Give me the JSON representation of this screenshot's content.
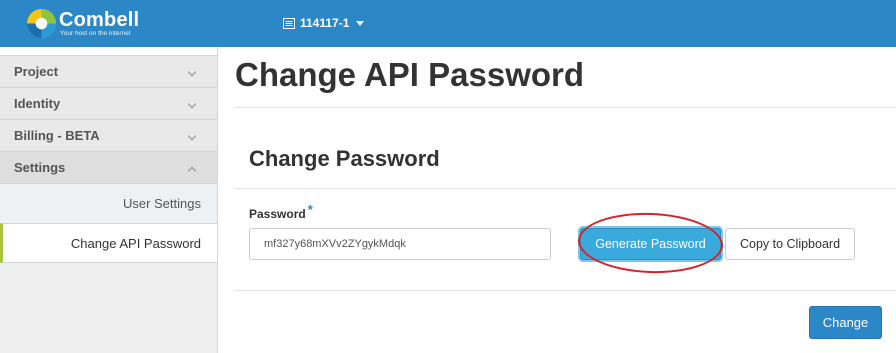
{
  "header": {
    "logo_name": "Combell",
    "logo_tagline": "Your host on the internet",
    "account_label": "114117-1",
    "account_icon": "server-list-icon",
    "background": "#2b87c6"
  },
  "sidebar": {
    "items": [
      {
        "label": "Project",
        "icon": "chevron-down-icon"
      },
      {
        "label": "Identity",
        "icon": "chevron-down-icon"
      },
      {
        "label": "Billing - BETA",
        "icon": "chevron-down-icon"
      },
      {
        "label": "Settings",
        "icon": "chevron-up-icon"
      }
    ],
    "sub_items": [
      {
        "label": "User Settings"
      },
      {
        "label": "Change API Password",
        "active": true
      }
    ],
    "active_accent": "#a6c63d"
  },
  "main": {
    "page_title": "Change API Password",
    "section_title": "Change Password",
    "password_label": "Password",
    "required_mark": "*",
    "password_value": "mf327y68mXVv2ZYgykMdqk",
    "generate_label": "Generate Password",
    "copy_label": "Copy to Clipboard",
    "change_label": "Change",
    "highlight_color": "#d62229",
    "primary_color": "#2b87c6"
  }
}
